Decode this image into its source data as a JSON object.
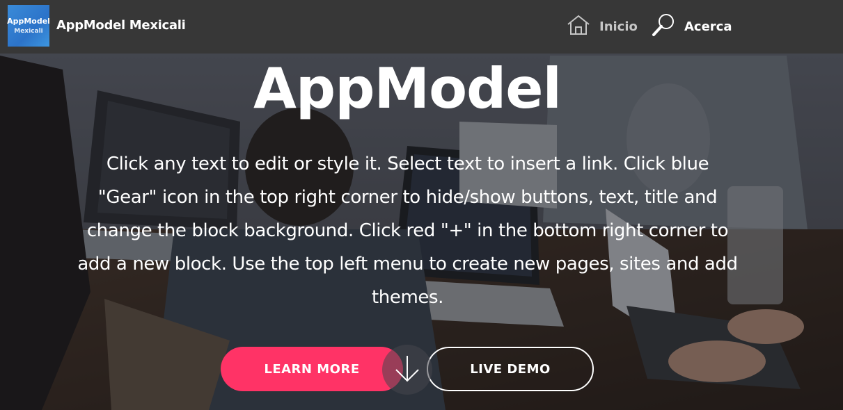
{
  "navbar": {
    "logo_line1": "AppModel",
    "logo_line2": "Mexicali",
    "brand": "AppModel Mexicali",
    "links": [
      {
        "label": "Inicio",
        "icon": "home-icon"
      },
      {
        "label": "Acerca",
        "icon": "magnifier-icon"
      }
    ]
  },
  "hero": {
    "title": "AppModel",
    "text": "Click any text to edit or style it. Select text to insert a link. Click blue \"Gear\" icon in the top right corner to hide/show buttons, text, title and change the block background. Click red \"+\" in the bottom right corner to add a new block. Use the top left menu to create new pages, sites and add themes.",
    "buttons": {
      "learn_more": "LEARN MORE",
      "live_demo": "LIVE DEMO"
    },
    "scroll_icon": "arrow-down-icon"
  },
  "colors": {
    "navbar_bg": "#373737",
    "primary_button": "#ff3366",
    "logo_bg": "#2c73c9",
    "text": "#ffffff",
    "nav_muted": "#c6c6c6"
  }
}
